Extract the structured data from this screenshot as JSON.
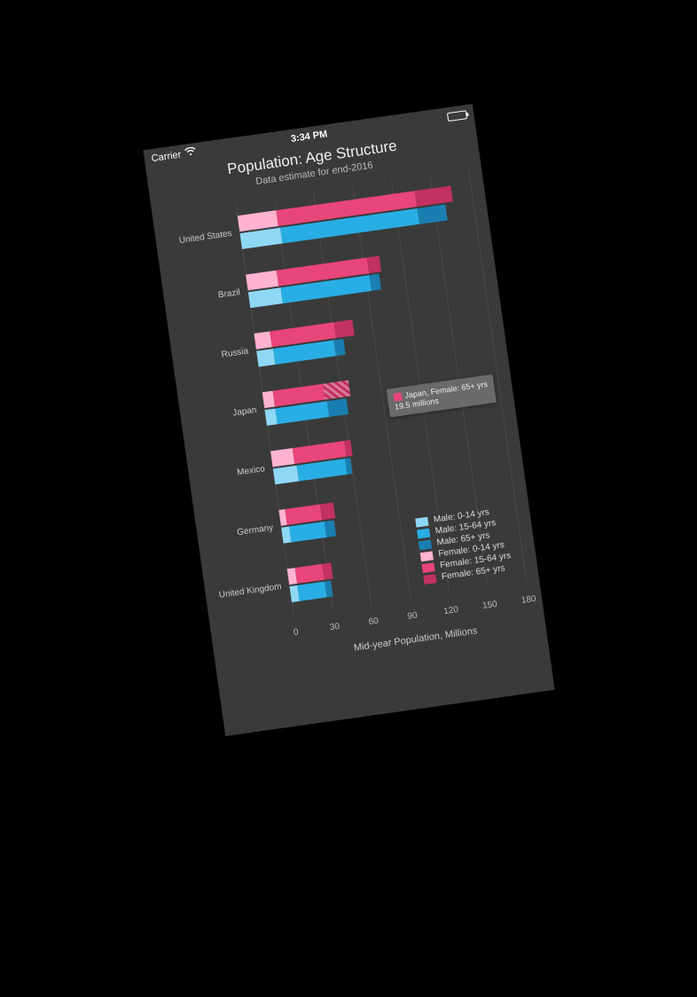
{
  "status": {
    "carrier": "Carrier",
    "time": "3:34 PM"
  },
  "title": "Population: Age Structure",
  "subtitle": "Data estimate for end-2016",
  "xlabel": "Mid-year Population, Millions",
  "x_ticks": [
    0,
    30,
    60,
    90,
    120,
    150,
    180
  ],
  "x_max": 180,
  "legend": [
    {
      "label": "Male: 0-14 yrs",
      "class": "l0m"
    },
    {
      "label": "Male: 15-64 yrs",
      "class": "l1m"
    },
    {
      "label": "Male: 65+ yrs",
      "class": "l2m"
    },
    {
      "label": "Female: 0-14 yrs",
      "class": "l0f"
    },
    {
      "label": "Female: 15-64 yrs",
      "class": "l1f"
    },
    {
      "label": "Female: 65+ yrs",
      "class": "l2f"
    }
  ],
  "tooltip": {
    "line1": "Japan, Female: 65+ yrs",
    "line2": "19.5 millions"
  },
  "chart_data": {
    "type": "bar",
    "orientation": "horizontal",
    "stacked": true,
    "title": "Population: Age Structure",
    "subtitle": "Data estimate for end-2016",
    "xlabel": "Mid-year Population, Millions",
    "ylabel": "",
    "xlim": [
      0,
      180
    ],
    "categories": [
      "United States",
      "Brazil",
      "Russia",
      "Japan",
      "Mexico",
      "Germany",
      "United Kingdom"
    ],
    "series_female": [
      {
        "name": "Female: 0-14 yrs",
        "values": [
          30,
          24,
          12,
          8,
          17,
          5,
          6
        ]
      },
      {
        "name": "Female: 15-64 yrs",
        "values": [
          107,
          70,
          50,
          39,
          40,
          27,
          21
        ]
      },
      {
        "name": "Female: 65+ yrs",
        "values": [
          28,
          9,
          14,
          19.5,
          5,
          10,
          7
        ]
      }
    ],
    "series_male": [
      {
        "name": "Male: 0-14 yrs",
        "values": [
          31,
          25,
          13,
          8,
          18,
          6,
          6
        ]
      },
      {
        "name": "Male: 15-64 yrs",
        "values": [
          106,
          69,
          47,
          40,
          38,
          27,
          21
        ]
      },
      {
        "name": "Male: 65+ yrs",
        "values": [
          22,
          7,
          7,
          15,
          4,
          8,
          5
        ]
      }
    ],
    "highlight": {
      "category": "Japan",
      "series": "Female: 65+ yrs",
      "value": 19.5
    }
  }
}
